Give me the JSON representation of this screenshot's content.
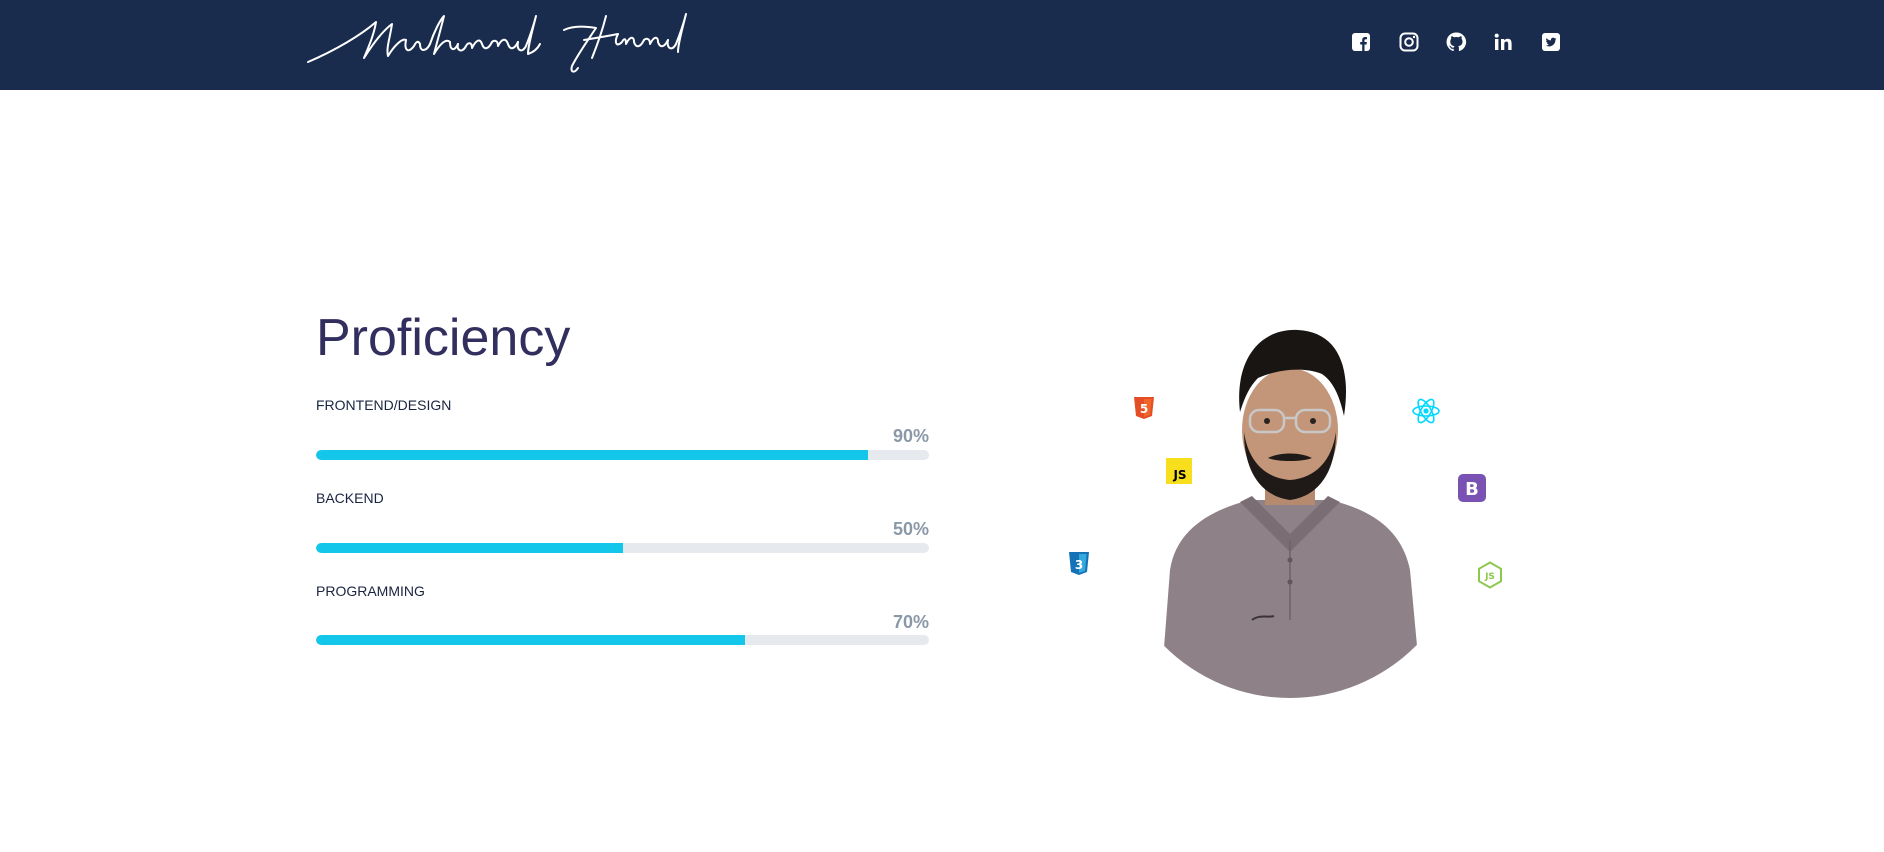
{
  "header": {
    "brand_name": "Muhammad Hammad",
    "social_icons": [
      "facebook-icon",
      "instagram-icon",
      "github-icon",
      "linkedin-icon",
      "twitter-icon"
    ]
  },
  "proficiency": {
    "title": "Proficiency",
    "skills": [
      {
        "label": "FRONTEND/DESIGN",
        "percent_label": "90%",
        "level": 90
      },
      {
        "label": "BACKEND",
        "percent_label": "50%",
        "level": 50
      },
      {
        "label": "PROGRAMMING",
        "percent_label": "70%",
        "level": 70
      }
    ]
  },
  "tech_icons": [
    {
      "name": "html5-icon",
      "text": "5",
      "color": "#e44d26"
    },
    {
      "name": "javascript-icon",
      "text": "JS",
      "color": "#f7df1e"
    },
    {
      "name": "css3-icon",
      "text": "3",
      "color": "#1572b6"
    },
    {
      "name": "react-icon",
      "color": "#00d8ff"
    },
    {
      "name": "bootstrap-icon",
      "text": "B",
      "color": "#7952b3"
    },
    {
      "name": "nodejs-icon",
      "text": "JS",
      "color": "#8cc84b"
    }
  ],
  "colors": {
    "navbar": "#1a2c4e",
    "accent": "#14c6ea",
    "title": "#322f5e",
    "track": "#e6e9ed",
    "percent": "#8a98a8"
  }
}
